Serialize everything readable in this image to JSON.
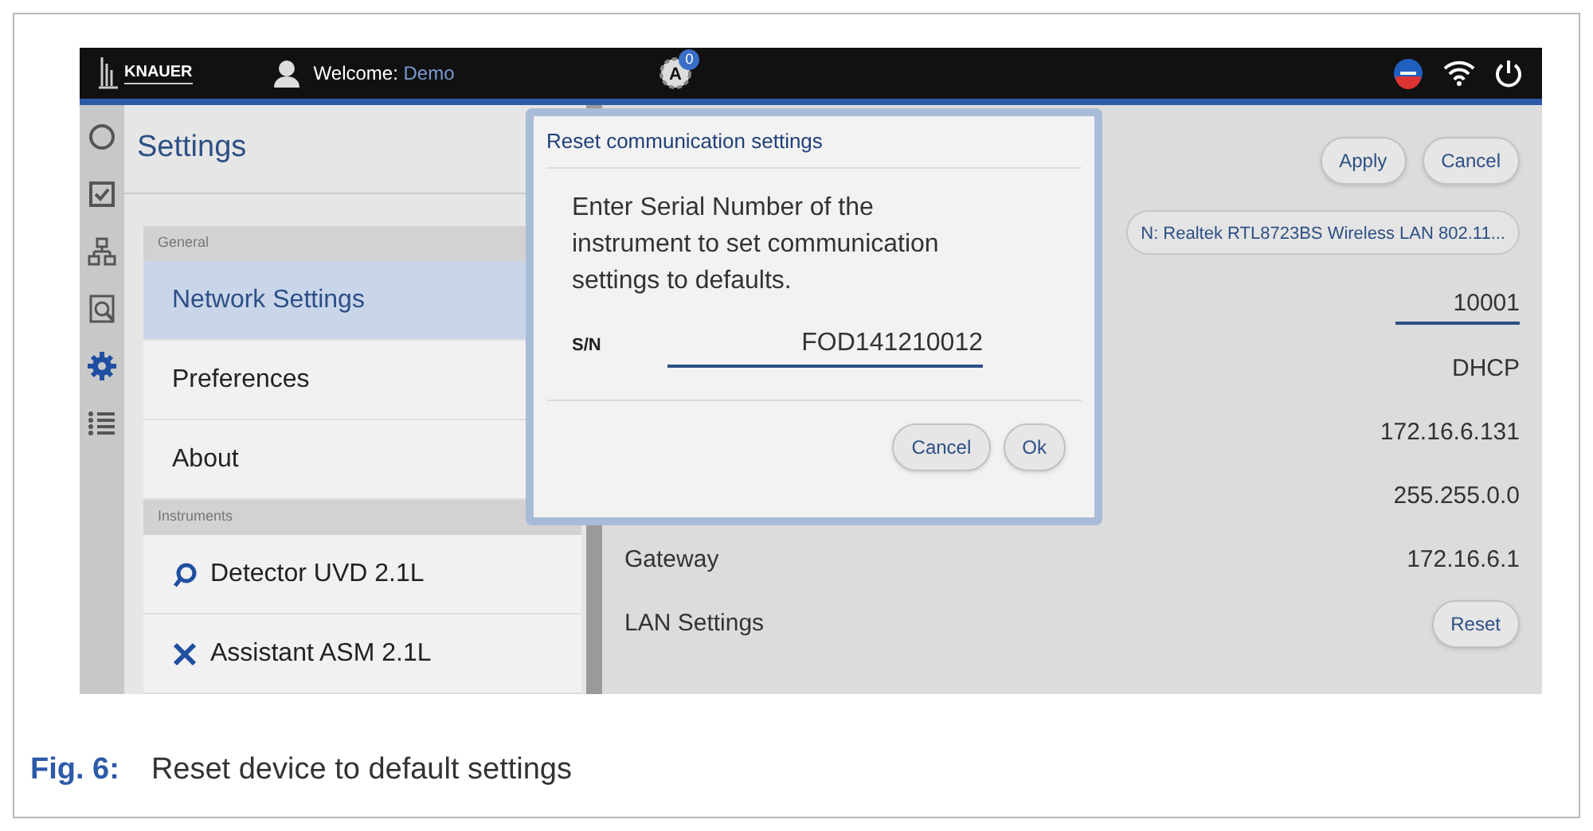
{
  "top_bar": {
    "brand": "KNAUER",
    "welcome_label": "Welcome:",
    "user": "Demo",
    "badge": "0",
    "app_letter": "A"
  },
  "rail": [
    {
      "kind": "ring",
      "selected": false
    },
    {
      "kind": "check",
      "selected": false
    },
    {
      "kind": "tree",
      "selected": false
    },
    {
      "kind": "search",
      "selected": false
    },
    {
      "kind": "gear",
      "selected": true
    },
    {
      "kind": "list",
      "selected": false
    }
  ],
  "settings_title": "Settings",
  "sections": [
    {
      "header": "General",
      "items": [
        {
          "label": "Network Settings",
          "selected": true
        },
        {
          "label": "Preferences",
          "selected": false
        },
        {
          "label": "About",
          "selected": false
        }
      ]
    },
    {
      "header": "Instruments",
      "items": [
        {
          "label": "Detector UVD 2.1L",
          "kind": "detector",
          "selected": false
        },
        {
          "label": "Assistant ASM 2.1L",
          "kind": "assistant",
          "selected": false
        }
      ]
    }
  ],
  "actions": [
    "Apply",
    "Cancel"
  ],
  "adapter": "N: Realtek RTL8723BS Wireless LAN 802.11...",
  "rows": [
    {
      "kind": "input",
      "value": "10001"
    },
    {
      "kind": "text",
      "value": "DHCP"
    },
    {
      "kind": "text",
      "value": "172.16.6.131"
    },
    {
      "kind": "text",
      "value": "255.255.0.0"
    },
    {
      "kind": "text",
      "label": "Gateway",
      "value": "172.16.6.1"
    },
    {
      "kind": "button",
      "label": "LAN Settings",
      "value": "Reset"
    }
  ],
  "dialog": {
    "title": "Reset communication settings",
    "message": "Enter Serial Number of the instrument to set communication settings to defaults.",
    "field_label": "S/N",
    "value": "FOD141210012",
    "buttons": [
      "Cancel",
      "Ok"
    ]
  },
  "caption": {
    "number": "Fig. 6:",
    "text": "Reset device to default settings"
  }
}
